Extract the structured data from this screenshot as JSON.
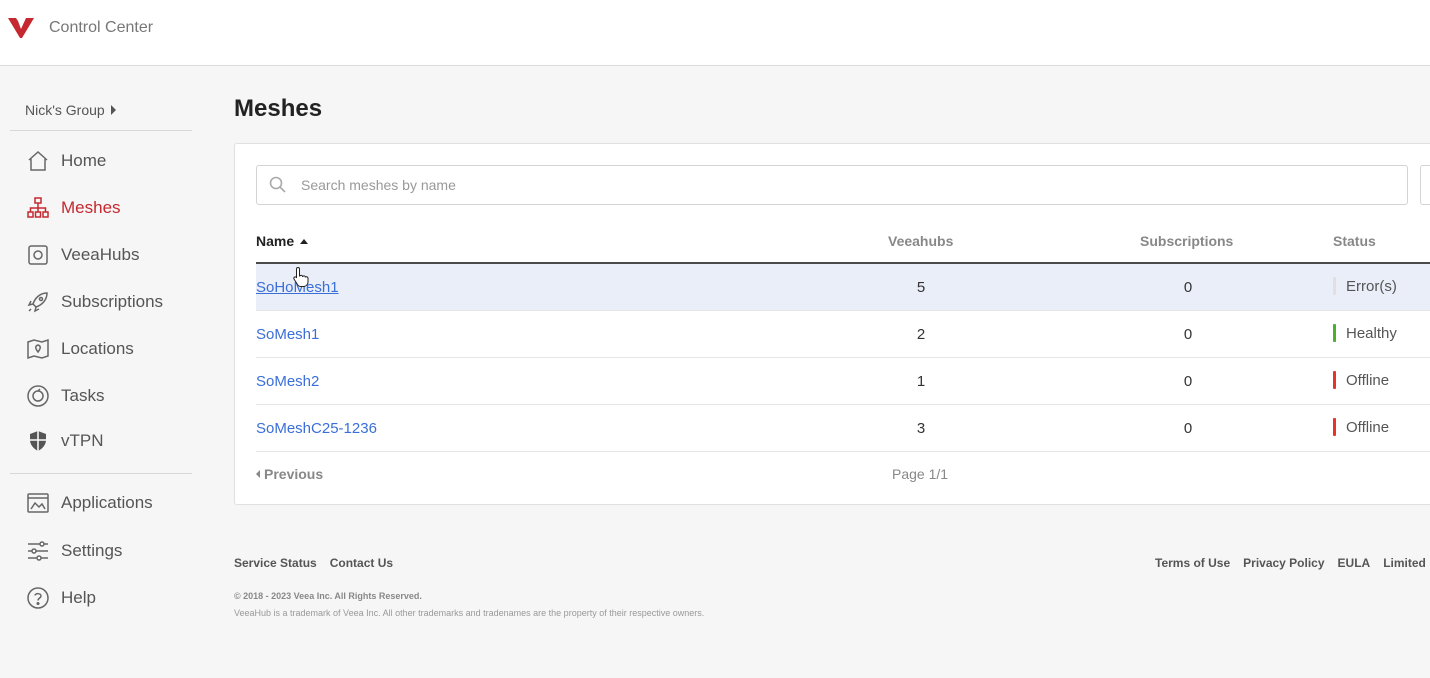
{
  "header": {
    "app_title": "Control Center"
  },
  "sidebar": {
    "group": "Nick's Group",
    "items": [
      {
        "label": "Home",
        "icon": "home-icon"
      },
      {
        "label": "Meshes",
        "icon": "mesh-icon",
        "active": true
      },
      {
        "label": "VeeaHubs",
        "icon": "veeahub-icon"
      },
      {
        "label": "Subscriptions",
        "icon": "rocket-icon"
      },
      {
        "label": "Locations",
        "icon": "map-pin-icon"
      },
      {
        "label": "Tasks",
        "icon": "tasks-icon"
      },
      {
        "label": "vTPN",
        "icon": "shield-icon"
      },
      {
        "label": "Applications",
        "icon": "applications-icon"
      },
      {
        "label": "Settings",
        "icon": "sliders-icon"
      },
      {
        "label": "Help",
        "icon": "help-icon"
      }
    ]
  },
  "main": {
    "title": "Meshes",
    "search": {
      "placeholder": "Search meshes by name",
      "value": ""
    },
    "table": {
      "columns": [
        "Name",
        "Veeahubs",
        "Subscriptions",
        "Status"
      ],
      "rows": [
        {
          "name": "SoHoMesh1",
          "veeahubs": "5",
          "subscriptions": "0",
          "status": "Error(s)",
          "status_color": "#e0e0e0"
        },
        {
          "name": "SoMesh1",
          "veeahubs": "2",
          "subscriptions": "0",
          "status": "Healthy",
          "status_color": "#4caf2e"
        },
        {
          "name": "SoMesh2",
          "veeahubs": "1",
          "subscriptions": "0",
          "status": "Offline",
          "status_color": "#e5352b"
        },
        {
          "name": "SoMeshC25-1236",
          "veeahubs": "3",
          "subscriptions": "0",
          "status": "Offline",
          "status_color": "#e5352b"
        }
      ]
    },
    "pager": {
      "previous": "Previous",
      "page": "Page 1/1"
    }
  },
  "footer": {
    "service_status": "Service Status",
    "contact_us": "Contact Us",
    "terms": "Terms of Use",
    "privacy": "Privacy Policy",
    "eula": "EULA",
    "limited": "Limited",
    "copyright": "© 2018 - 2023 Veea Inc. All Rights Reserved.",
    "trademark": "VeeaHub is a trademark of Veea Inc. All other trademarks and tradenames are the property of their respective owners."
  },
  "colors": {
    "accent": "#c5282f",
    "link": "#3a6fd8"
  }
}
